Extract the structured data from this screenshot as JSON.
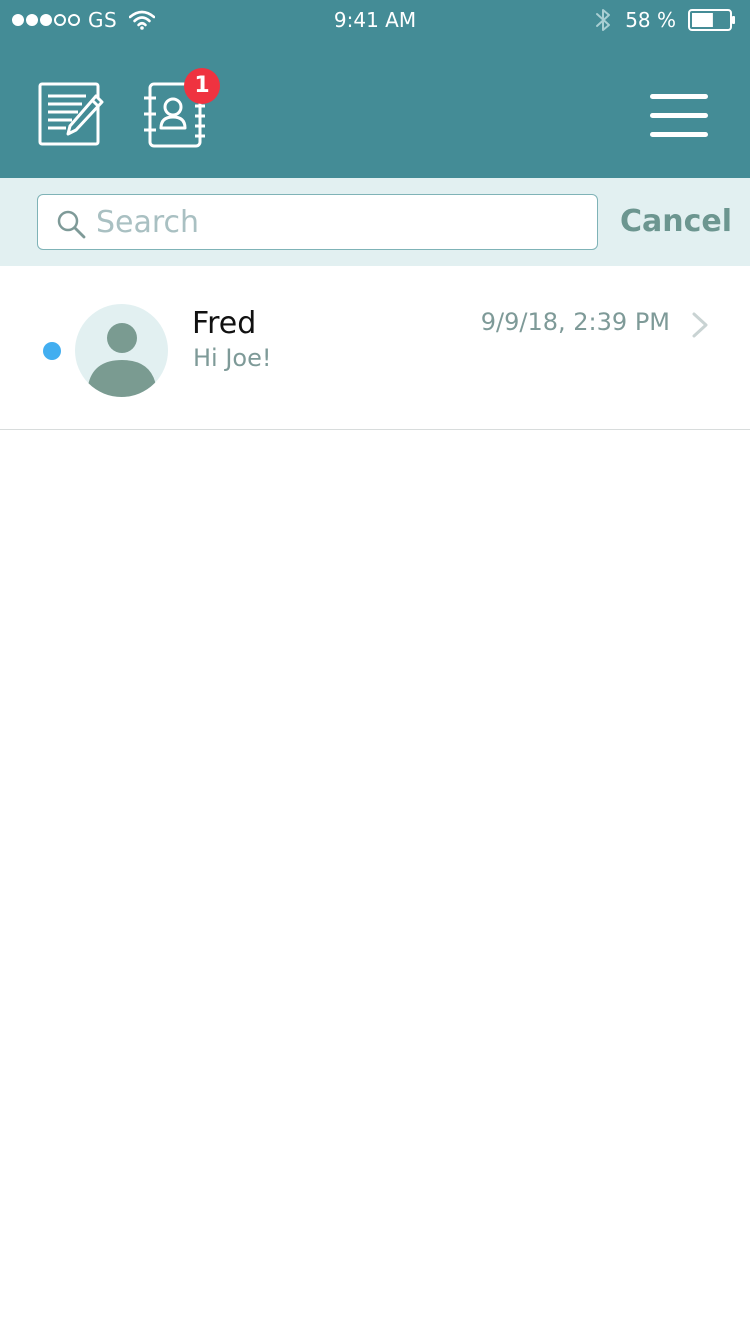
{
  "status_bar": {
    "carrier": "GS",
    "time": "9:41 AM",
    "battery_percent": "58 %",
    "battery_level": 0.58,
    "signal_bars": 3,
    "signal_total": 5
  },
  "header": {
    "compose_icon": "compose-note-icon",
    "contacts_icon": "address-book-icon",
    "contacts_badge": "1",
    "menu_icon": "hamburger-menu-icon"
  },
  "search": {
    "placeholder": "Search",
    "value": "",
    "cancel_label": "Cancel"
  },
  "conversations": [
    {
      "name": "Fred",
      "preview": "Hi Joe!",
      "timestamp": "9/9/18, 2:39 PM",
      "unread": true
    }
  ],
  "colors": {
    "header_bg": "#448c96",
    "search_bar_bg": "#e2f0f1",
    "badge": "#ef3340",
    "unread_dot": "#42aef0",
    "avatar_fg": "#7a9b91"
  }
}
